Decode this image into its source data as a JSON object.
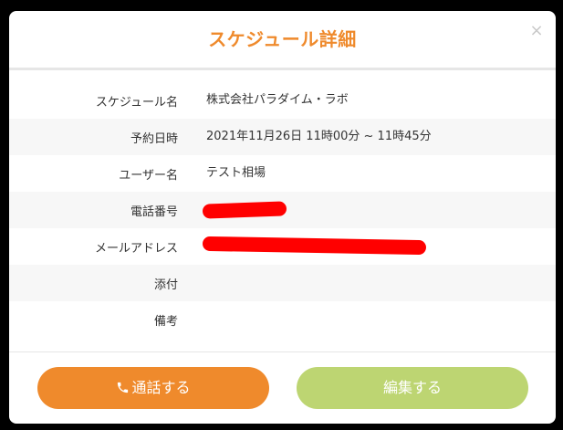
{
  "modal": {
    "title": "スケジュール詳細",
    "close_icon": "×"
  },
  "details": [
    {
      "label": "スケジュール名",
      "value": "株式会社パラダイム・ラボ"
    },
    {
      "label": "予約日時",
      "value": "2021年11月26日 11時00分 ~ 11時45分"
    },
    {
      "label": "ユーザー名",
      "value": "テスト相場"
    },
    {
      "label": "電話番号",
      "value": ""
    },
    {
      "label": "メールアドレス",
      "value": ""
    },
    {
      "label": "添付",
      "value": ""
    },
    {
      "label": "備考",
      "value": ""
    }
  ],
  "buttons": {
    "call_label": "通話する",
    "edit_label": "編集する"
  },
  "colors": {
    "accent_orange": "#ef8a2c",
    "edit_green": "#bdd572",
    "redaction_red": "#ff0000"
  },
  "icons": {
    "call": "phone-icon",
    "close": "close-icon"
  }
}
